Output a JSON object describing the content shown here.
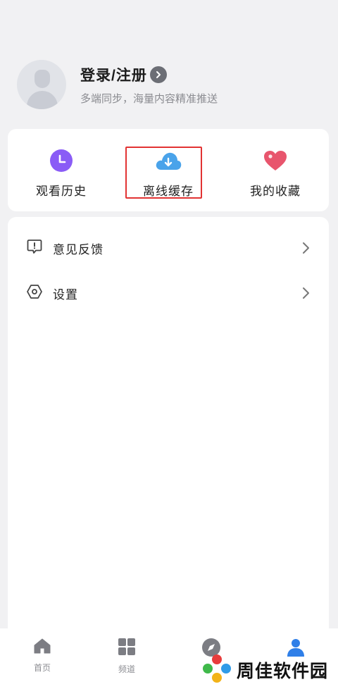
{
  "profile": {
    "title": "登录/注册",
    "subtitle": "多端同步，海量内容精准推送"
  },
  "quick_actions": [
    {
      "label": "观看历史",
      "icon": "clock-icon",
      "color": "#8a5cf6"
    },
    {
      "label": "离线缓存",
      "icon": "cloud-download-icon",
      "color": "#4aa3ea"
    },
    {
      "label": "我的收藏",
      "icon": "heart-icon",
      "color": "#e8556d"
    }
  ],
  "menu": [
    {
      "label": "意见反馈",
      "icon": "feedback-icon"
    },
    {
      "label": "设置",
      "icon": "settings-icon"
    }
  ],
  "tabbar": [
    {
      "label": "首页",
      "icon": "home-icon"
    },
    {
      "label": "频道",
      "icon": "grid-icon"
    },
    {
      "label": "",
      "icon": "compass-icon"
    },
    {
      "label": "",
      "icon": "user-icon",
      "active": true,
      "color": "#2f7fe8"
    }
  ],
  "watermark": {
    "text": "周佳软件园"
  }
}
